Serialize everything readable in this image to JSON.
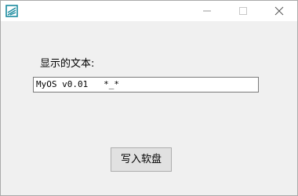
{
  "titlebar": {
    "app_icon": "app-icon",
    "minimize_icon": "minimize-icon",
    "maximize_icon": "maximize-icon",
    "close_icon": "close-icon"
  },
  "form": {
    "label": "显示的文本:",
    "text_value": "MyOS v0.01   *_*",
    "button_label": "写入软盘"
  },
  "colors": {
    "window_bg": "#f0f0f0",
    "titlebar_bg": "#ffffff",
    "icon_accent": "#1a8a9e",
    "button_bg": "#e1e1e1"
  }
}
